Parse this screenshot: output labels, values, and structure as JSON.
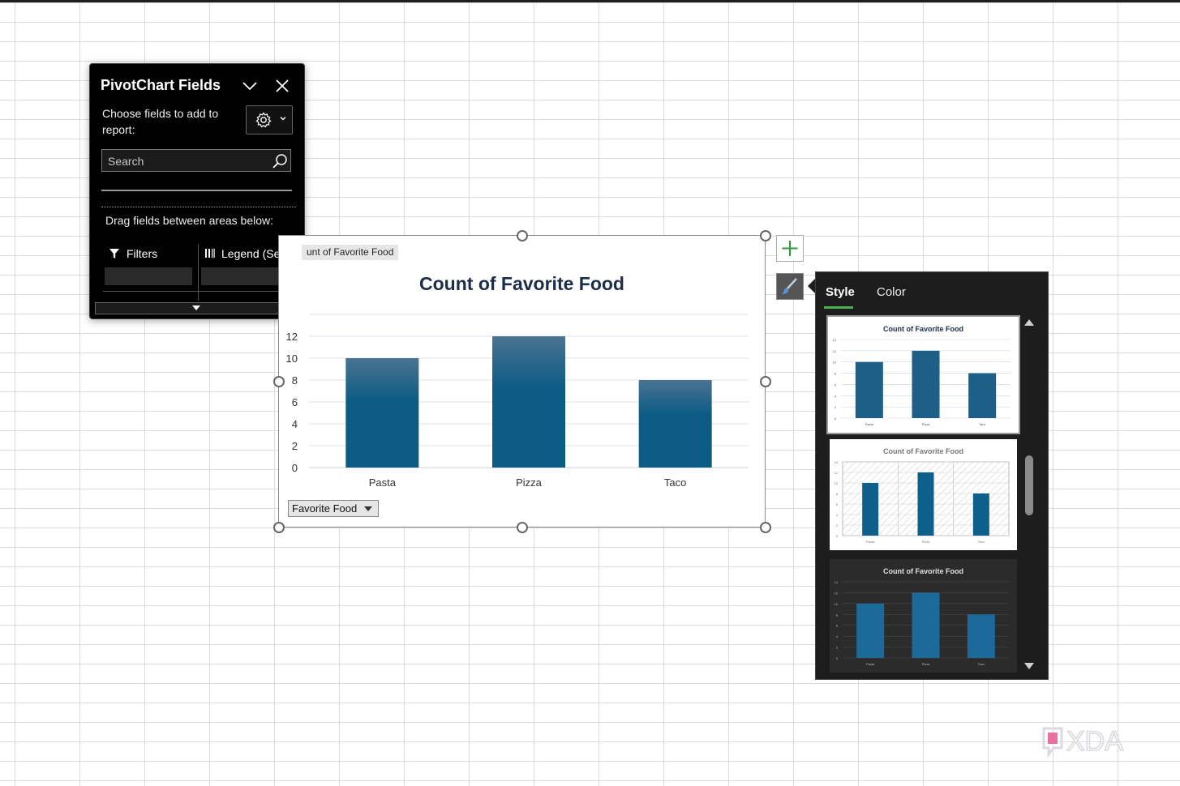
{
  "pane": {
    "title": "PivotChart Fields",
    "choose_text": "Choose fields to add to report:",
    "search_placeholder": "Search",
    "drag_text": "Drag fields between areas below:",
    "filters_label": "Filters",
    "legend_label": "Legend (Se..."
  },
  "chart": {
    "value_field_button": "unt of Favorite Food",
    "axis_field_button": "Favorite Food",
    "bar_color_top": "#4a7391",
    "bar_color_bottom": "#0b5b85"
  },
  "chart_data": {
    "type": "bar",
    "title": "Count of Favorite Food",
    "categories": [
      "Pasta",
      "Pizza",
      "Taco"
    ],
    "values": [
      10,
      12,
      8
    ],
    "yticks": [
      0,
      2,
      4,
      6,
      8,
      10,
      12
    ],
    "ylim": [
      0,
      14
    ],
    "grid": true,
    "xlabel": "",
    "ylabel": ""
  },
  "style_panel": {
    "tab_style": "Style",
    "tab_color": "Color",
    "thumb_title": "Count of Favorite Food",
    "accent": "#4caf50"
  },
  "branding": {
    "logo_text": "XDA"
  }
}
